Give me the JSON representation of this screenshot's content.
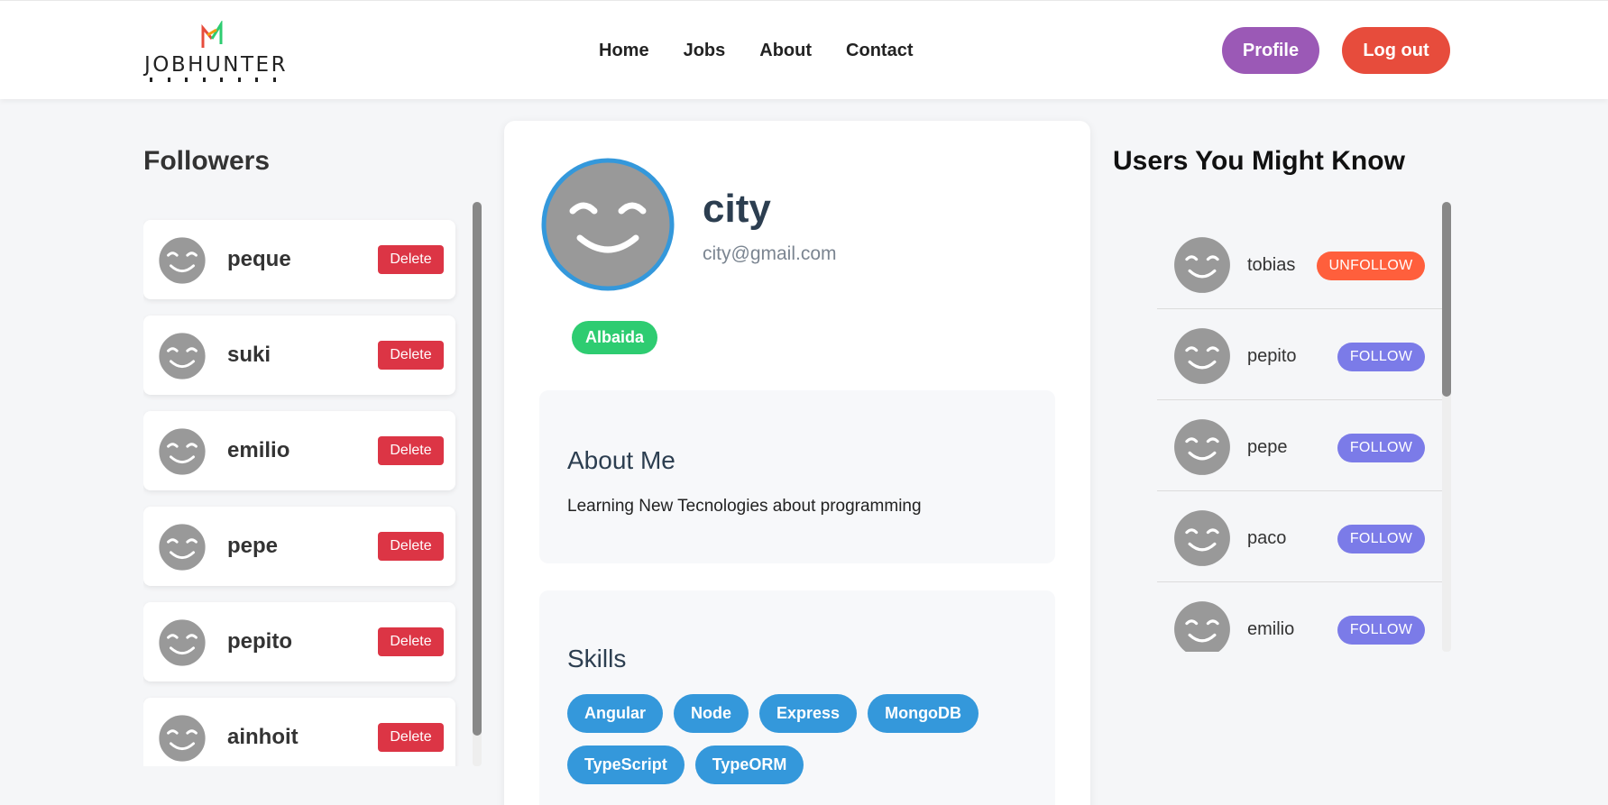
{
  "header": {
    "logo_text": "JOBHUNTER",
    "nav": [
      "Home",
      "Jobs",
      "About",
      "Contact"
    ],
    "profile_label": "Profile",
    "logout_label": "Log out"
  },
  "followers": {
    "title": "Followers",
    "delete_label": "Delete",
    "items": [
      {
        "name": "peque"
      },
      {
        "name": "suki"
      },
      {
        "name": "emilio"
      },
      {
        "name": "pepe"
      },
      {
        "name": "pepito"
      },
      {
        "name": "ainhoit"
      }
    ]
  },
  "profile": {
    "name": "city",
    "email": "city@gmail.com",
    "location": "Albaida",
    "about_title": "About Me",
    "about_text": "Learning New Tecnologies about programming",
    "skills_title": "Skills",
    "skills": [
      "Angular",
      "Node",
      "Express",
      "MongoDB",
      "TypeScript",
      "TypeORM"
    ]
  },
  "suggestions": {
    "title": "Users You Might Know",
    "items": [
      {
        "name": "tobias",
        "action": "UNFOLLOW"
      },
      {
        "name": "pepito",
        "action": "FOLLOW"
      },
      {
        "name": "pepe",
        "action": "FOLLOW"
      },
      {
        "name": "paco",
        "action": "FOLLOW"
      },
      {
        "name": "emilio",
        "action": "FOLLOW"
      }
    ]
  },
  "colors": {
    "profile_button": "#9b59b6",
    "logout_button": "#e74c3c",
    "delete_button": "#dc3545",
    "unfollow_button": "#ff5f3c",
    "follow_button": "#7b7be8",
    "location_badge": "#2ecc71",
    "skill_badge": "#3498db",
    "avatar_ring": "#3498db"
  }
}
